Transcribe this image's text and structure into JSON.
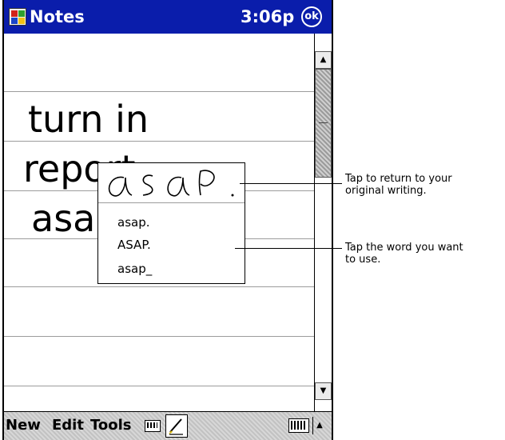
{
  "titlebar": {
    "app_title": "Notes",
    "time": "3:06p",
    "ok_label": "ok"
  },
  "note": {
    "lines": [
      "turn in",
      "report",
      "asap"
    ]
  },
  "popup": {
    "handwritten": "asap.",
    "alternates": [
      "asap.",
      "ASAP.",
      "asap_"
    ]
  },
  "commandbar": {
    "menus": [
      "New",
      "Edit",
      "Tools"
    ]
  },
  "callouts": {
    "return_original": "Tap to return to your\noriginal writing.",
    "choose_word": "Tap the word you want\nto use."
  },
  "colors": {
    "titlebar": "#0a1dab",
    "rule_lines": "#9c9c9c"
  },
  "icons": {
    "start": "windows-flag-icon",
    "keyboard_small": "keyboard-icon",
    "pen": "pen-icon",
    "input_panel": "keyboard-icon",
    "scroll_up": "arrow-up-icon",
    "scroll_down": "arrow-down-icon"
  }
}
